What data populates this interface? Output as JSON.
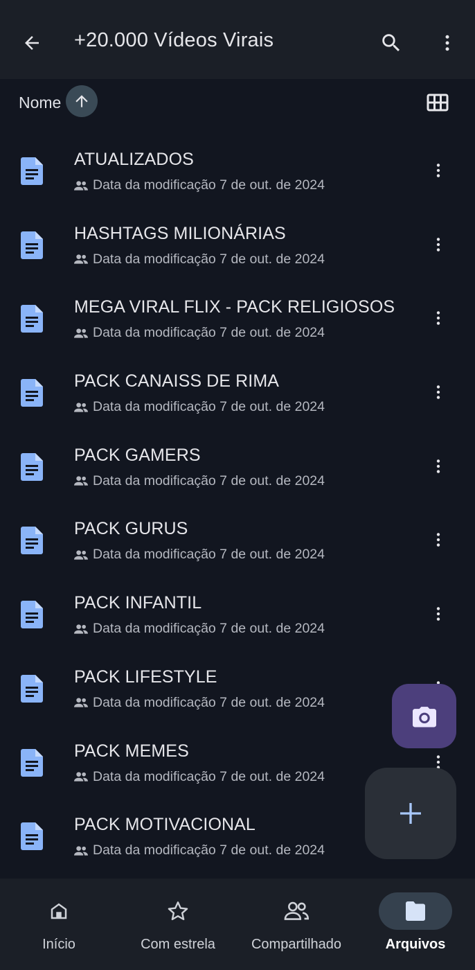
{
  "header": {
    "title": "+20.000 Vídeos Virais"
  },
  "sort": {
    "label": "Nome"
  },
  "files": [
    {
      "name": "ATUALIZADOS",
      "meta": "Data da modificação 7 de out. de 2024"
    },
    {
      "name": "HASHTAGS MILIONÁRIAS",
      "meta": "Data da modificação 7 de out. de 2024"
    },
    {
      "name": "MEGA VIRAL FLIX - PACK RELIGIOSOS",
      "meta": "Data da modificação 7 de out. de 2024"
    },
    {
      "name": "PACK CANAISS DE RIMA",
      "meta": "Data da modificação 7 de out. de 2024"
    },
    {
      "name": "PACK GAMERS",
      "meta": "Data da modificação 7 de out. de 2024"
    },
    {
      "name": "PACK GURUS",
      "meta": "Data da modificação 7 de out. de 2024"
    },
    {
      "name": "PACK INFANTIL",
      "meta": "Data da modificação 7 de out. de 2024"
    },
    {
      "name": "PACK LIFESTYLE",
      "meta": "Data da modificação 7 de out. de 2024"
    },
    {
      "name": "PACK MEMES",
      "meta": "Data da modificação 7 de out. de 2024"
    },
    {
      "name": "PACK MOTIVACIONAL",
      "meta": "Data da modificação 7 de out. de 2024"
    }
  ],
  "nav": {
    "items": [
      {
        "label": "Início",
        "icon": "home-icon"
      },
      {
        "label": "Com estrela",
        "icon": "star-icon"
      },
      {
        "label": "Compartilhado",
        "icon": "people-icon"
      },
      {
        "label": "Arquivos",
        "icon": "folder-icon",
        "active": true
      }
    ]
  },
  "colors": {
    "background": "#121620",
    "bar": "#1b1f27",
    "doc_icon": "#8ab4f8",
    "fab_camera": "#4c3f7c",
    "fab_add": "#2a2f37",
    "active_pill": "#35414e"
  }
}
